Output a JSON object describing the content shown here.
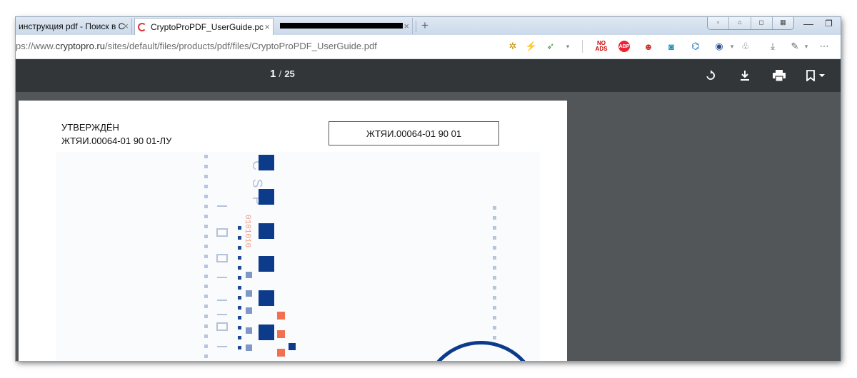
{
  "tabs": [
    {
      "label": "инструкция pdf - Поиск в С"
    },
    {
      "label": "CryptoProPDF_UserGuide.pc"
    }
  ],
  "window_buttons": {
    "close_all": "×"
  },
  "address": {
    "prefix": "ps://www.",
    "domain": "cryptopro.ru",
    "path": "/sites/default/files/products/pdf/files/CryptoProPDF_UserGuide.pdf"
  },
  "toolbar_icons": {
    "noads": "NO ADS",
    "abp": "ABP"
  },
  "pdf": {
    "current_page": "1",
    "separator": "/",
    "total_pages": "25",
    "approved_label": "УТВЕРЖДЁН",
    "doc_code_approved": "ЖТЯИ.00064-01 90 01-ЛУ",
    "doc_code": "ЖТЯИ.00064-01 90 01",
    "csp_letters": "CSP",
    "binary": "0101010"
  },
  "colors": {
    "toolbar_bg": "#323639",
    "viewer_bg": "#525659",
    "accent_blue": "#0d3b8c",
    "accent_orange": "#f07050"
  }
}
